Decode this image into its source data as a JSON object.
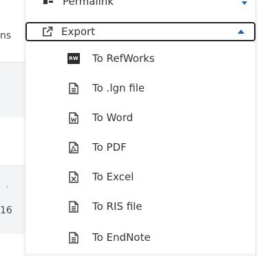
{
  "background": {
    "text_top": "ns",
    "text_bottom": "16",
    "chevron": "›"
  },
  "menu": {
    "cut_item": {
      "label": "Permalink",
      "icon": "link-icon"
    },
    "export": {
      "label": "Export",
      "icon": "external-link-icon",
      "state": "expanded",
      "accent_color": "#1a5fa8"
    },
    "items": [
      {
        "label": "To RefWorks",
        "icon": "refworks-icon",
        "badge": "RW"
      },
      {
        "label": "To .lgn file",
        "icon": "file-lines-icon"
      },
      {
        "label": "To Word",
        "icon": "file-word-icon"
      },
      {
        "label": "To PDF",
        "icon": "file-pdf-icon"
      },
      {
        "label": "To Excel",
        "icon": "file-excel-icon"
      },
      {
        "label": "To RIS file",
        "icon": "file-lines-icon"
      },
      {
        "label": "To EndNote",
        "icon": "file-lines-icon"
      }
    ]
  }
}
